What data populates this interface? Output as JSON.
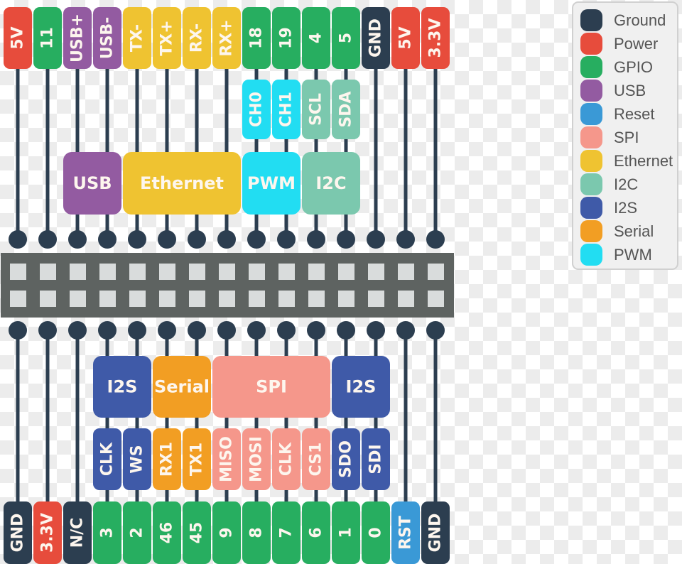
{
  "colors": {
    "Ground": "#2c3e50",
    "Power": "#e74c3c",
    "GPIO": "#27ae60",
    "USB": "#935ba1",
    "Reset": "#3a99d6",
    "SPI": "#f5978b",
    "Ethernet": "#efc331",
    "I2C": "#7bc8ae",
    "I2S": "#3f5aa8",
    "Serial": "#f29e23",
    "PWM": "#22ddf2",
    "line": "#2c3e50",
    "header": "#5e6361",
    "header_hole": "#d9dcdc"
  },
  "top": {
    "pins": [
      {
        "label": "5V",
        "type": "Power"
      },
      {
        "label": "11",
        "type": "GPIO"
      },
      {
        "label": "USB+",
        "type": "USB"
      },
      {
        "label": "USB-",
        "type": "USB"
      },
      {
        "label": "TX-",
        "type": "Ethernet"
      },
      {
        "label": "TX+",
        "type": "Ethernet"
      },
      {
        "label": "RX-",
        "type": "Ethernet"
      },
      {
        "label": "RX+",
        "type": "Ethernet"
      },
      {
        "label": "18",
        "type": "GPIO"
      },
      {
        "label": "19",
        "type": "GPIO"
      },
      {
        "label": "4",
        "type": "GPIO"
      },
      {
        "label": "5",
        "type": "GPIO"
      },
      {
        "label": "GND",
        "type": "Ground"
      },
      {
        "label": "5V",
        "type": "Power"
      },
      {
        "label": "3.3V",
        "type": "Power"
      }
    ],
    "functions": [
      {
        "label": "CH0",
        "type": "PWM"
      },
      {
        "label": "CH1",
        "type": "PWM"
      },
      {
        "label": "SCL",
        "type": "I2C"
      },
      {
        "label": "SDA",
        "type": "I2C"
      }
    ],
    "groups": [
      {
        "label": "USB",
        "type": "USB"
      },
      {
        "label": "Ethernet",
        "type": "Ethernet"
      },
      {
        "label": "PWM",
        "type": "PWM"
      },
      {
        "label": "I2C",
        "type": "I2C"
      }
    ]
  },
  "bottom": {
    "pins": [
      {
        "label": "GND",
        "type": "Ground"
      },
      {
        "label": "3.3V",
        "type": "Power"
      },
      {
        "label": "N/C",
        "type": "Ground"
      },
      {
        "label": "3",
        "type": "GPIO"
      },
      {
        "label": "2",
        "type": "GPIO"
      },
      {
        "label": "46",
        "type": "GPIO"
      },
      {
        "label": "45",
        "type": "GPIO"
      },
      {
        "label": "9",
        "type": "GPIO"
      },
      {
        "label": "8",
        "type": "GPIO"
      },
      {
        "label": "7",
        "type": "GPIO"
      },
      {
        "label": "6",
        "type": "GPIO"
      },
      {
        "label": "1",
        "type": "GPIO"
      },
      {
        "label": "0",
        "type": "GPIO"
      },
      {
        "label": "RST",
        "type": "Reset"
      },
      {
        "label": "GND",
        "type": "Ground"
      }
    ],
    "functions": [
      {
        "label": "CLK",
        "type": "I2S"
      },
      {
        "label": "WS",
        "type": "I2S"
      },
      {
        "label": "RX1",
        "type": "Serial"
      },
      {
        "label": "TX1",
        "type": "Serial"
      },
      {
        "label": "MISO",
        "type": "SPI"
      },
      {
        "label": "MOSI",
        "type": "SPI"
      },
      {
        "label": "CLK",
        "type": "SPI"
      },
      {
        "label": "CS1",
        "type": "SPI"
      },
      {
        "label": "SDO",
        "type": "I2S"
      },
      {
        "label": "SDI",
        "type": "I2S"
      }
    ],
    "groups": [
      {
        "label": "I2S",
        "type": "I2S"
      },
      {
        "label": "Serial",
        "type": "Serial"
      },
      {
        "label": "SPI",
        "type": "SPI"
      },
      {
        "label": "I2S",
        "type": "I2S"
      }
    ]
  },
  "legend": [
    {
      "label": "Ground",
      "type": "Ground"
    },
    {
      "label": "Power",
      "type": "Power"
    },
    {
      "label": "GPIO",
      "type": "GPIO"
    },
    {
      "label": "USB",
      "type": "USB"
    },
    {
      "label": "Reset",
      "type": "Reset"
    },
    {
      "label": "SPI",
      "type": "SPI"
    },
    {
      "label": "Ethernet",
      "type": "Ethernet"
    },
    {
      "label": "I2C",
      "type": "I2C"
    },
    {
      "label": "I2S",
      "type": "I2S"
    },
    {
      "label": "Serial",
      "type": "Serial"
    },
    {
      "label": "PWM",
      "type": "PWM"
    }
  ]
}
